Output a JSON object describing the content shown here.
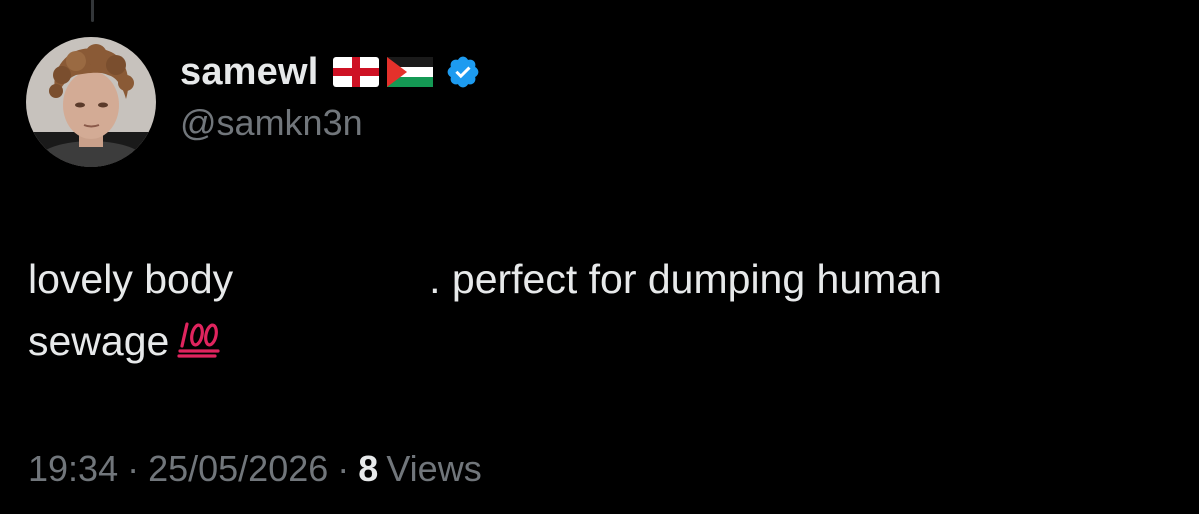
{
  "tweet": {
    "author": {
      "display_name": "samewl",
      "handle": "@samkn3n",
      "flags": [
        "england-flag-icon",
        "palestine-flag-icon"
      ],
      "verified": true,
      "verified_badge": "verified-badge-icon"
    },
    "text": {
      "line1_part1": "lovely body",
      "line1_part2": ". perfect for dumping human",
      "line2": "sewage",
      "emoji": "hundred-points-emoji"
    },
    "meta": {
      "time": "19:34",
      "date": "25/05/2026",
      "separator": "·",
      "views_count": "8",
      "views_label": "Views"
    }
  },
  "colors": {
    "background": "#000000",
    "primary_text": "#e7e9ea",
    "secondary_text": "#71767b",
    "verified_blue": "#1d9bf0",
    "hundred_red": "#e0245e"
  }
}
